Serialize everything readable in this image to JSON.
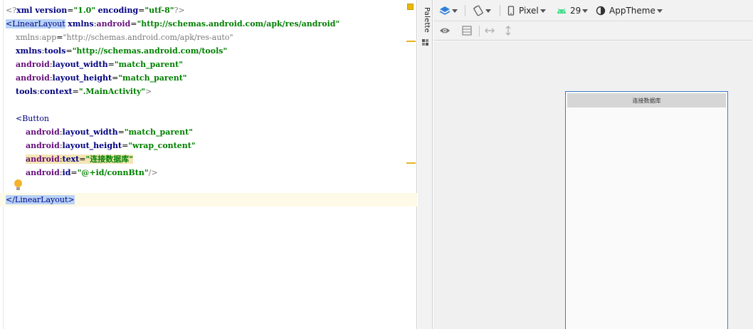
{
  "editor": {
    "lines": [
      [
        {
          "c": "bracket",
          "t": "<?"
        },
        {
          "c": "attr",
          "t": "xml version"
        },
        {
          "c": "eq",
          "t": "="
        },
        {
          "c": "val",
          "t": "\"1.0\""
        },
        {
          "c": "eq",
          "t": " "
        },
        {
          "c": "attr",
          "t": "encoding"
        },
        {
          "c": "eq",
          "t": "="
        },
        {
          "c": "val",
          "t": "\"utf-8\""
        },
        {
          "c": "bracket",
          "t": "?>"
        }
      ],
      [
        {
          "c": "tag hl",
          "t": "<LinearLayout"
        },
        {
          "c": "eq",
          "t": " "
        },
        {
          "c": "nsx",
          "t": "xmlns"
        },
        {
          "c": "eq",
          "t": ":"
        },
        {
          "c": "nsa",
          "t": "android"
        },
        {
          "c": "eq",
          "t": "="
        },
        {
          "c": "val",
          "t": "\"http://schemas.android.com/apk/res/android\""
        }
      ],
      [
        {
          "c": "eq",
          "t": "    "
        },
        {
          "c": "nsd",
          "t": "xmlns:app"
        },
        {
          "c": "eq",
          "t": "="
        },
        {
          "c": "vald",
          "t": "\"http://schemas.android.com/apk/res-auto\""
        }
      ],
      [
        {
          "c": "eq",
          "t": "    "
        },
        {
          "c": "nsx",
          "t": "xmlns"
        },
        {
          "c": "eq",
          "t": ":"
        },
        {
          "c": "nsx",
          "t": "tools"
        },
        {
          "c": "eq",
          "t": "="
        },
        {
          "c": "val",
          "t": "\"http://schemas.android.com/tools\""
        }
      ],
      [
        {
          "c": "eq",
          "t": "    "
        },
        {
          "c": "nsa",
          "t": "android"
        },
        {
          "c": "eq",
          "t": ":"
        },
        {
          "c": "attr",
          "t": "layout_width"
        },
        {
          "c": "eq",
          "t": "="
        },
        {
          "c": "val",
          "t": "\"match_parent\""
        }
      ],
      [
        {
          "c": "eq",
          "t": "    "
        },
        {
          "c": "nsa",
          "t": "android"
        },
        {
          "c": "eq",
          "t": ":"
        },
        {
          "c": "attr",
          "t": "layout_height"
        },
        {
          "c": "eq",
          "t": "="
        },
        {
          "c": "val",
          "t": "\"match_parent\""
        }
      ],
      [
        {
          "c": "eq",
          "t": "    "
        },
        {
          "c": "nsx",
          "t": "tools"
        },
        {
          "c": "eq",
          "t": ":"
        },
        {
          "c": "attr",
          "t": "context"
        },
        {
          "c": "eq",
          "t": "="
        },
        {
          "c": "val",
          "t": "\".MainActivity\""
        },
        {
          "c": "bracket",
          "t": ">"
        }
      ],
      [],
      [
        {
          "c": "eq",
          "t": "    "
        },
        {
          "c": "tag",
          "t": "<Button"
        }
      ],
      [
        {
          "c": "eq",
          "t": "        "
        },
        {
          "c": "nsa",
          "t": "android"
        },
        {
          "c": "eq",
          "t": ":"
        },
        {
          "c": "attr",
          "t": "layout_width"
        },
        {
          "c": "eq",
          "t": "="
        },
        {
          "c": "val",
          "t": "\"match_parent\""
        }
      ],
      [
        {
          "c": "eq",
          "t": "        "
        },
        {
          "c": "nsa",
          "t": "android"
        },
        {
          "c": "eq",
          "t": ":"
        },
        {
          "c": "attr",
          "t": "layout_height"
        },
        {
          "c": "eq",
          "t": "="
        },
        {
          "c": "val",
          "t": "\"wrap_content\""
        }
      ],
      [
        {
          "c": "eq",
          "t": "        "
        },
        {
          "c": "nsa attrhl",
          "t": "android"
        },
        {
          "c": "eq attrhl",
          "t": ":"
        },
        {
          "c": "attr attrhl",
          "t": "text"
        },
        {
          "c": "eq attrhl",
          "t": "="
        },
        {
          "c": "val attrhl",
          "t": "\"连接数据库\""
        }
      ],
      [
        {
          "c": "eq",
          "t": "        "
        },
        {
          "c": "nsa",
          "t": "android"
        },
        {
          "c": "eq",
          "t": ":"
        },
        {
          "c": "attr",
          "t": "id"
        },
        {
          "c": "eq",
          "t": "="
        },
        {
          "c": "val",
          "t": "\"@+id/connBtn\""
        },
        {
          "c": "bracket",
          "t": "/>"
        }
      ],
      [],
      [
        {
          "c": "tag hl",
          "t": "</LinearLayout>"
        }
      ]
    ],
    "caret_line": 14
  },
  "palette": {
    "label": "Palette"
  },
  "toolbar": {
    "device": "Pixel",
    "api": "29",
    "theme": "AppTheme"
  },
  "preview": {
    "button_text": "连接数据库"
  },
  "colors": {
    "accent": "#3d7ac9",
    "warning_marker": "#e6b422"
  }
}
